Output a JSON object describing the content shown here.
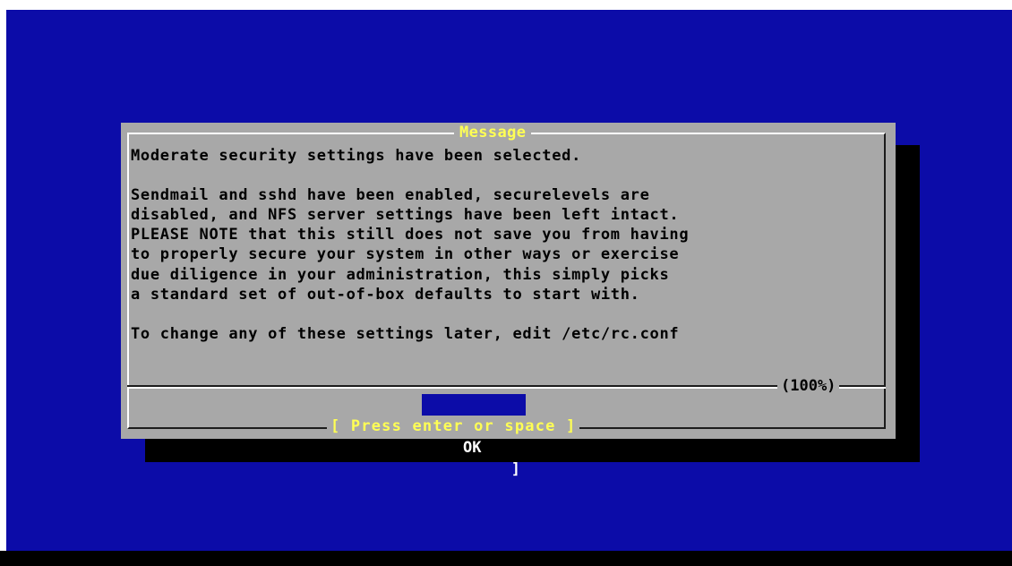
{
  "dialog": {
    "title": "Message",
    "lines": [
      "Moderate security settings have been selected.",
      "",
      "Sendmail and sshd have been enabled, securelevels are",
      "disabled, and NFS server settings have been left intact.",
      "PLEASE NOTE that this still does not save you from having",
      "to properly secure your system in other ways or exercise",
      "due diligence in your administration, this simply picks",
      "a standard set of out-of-box defaults to start with.",
      "",
      "To change any of these settings later, edit /etc/rc.conf"
    ],
    "scroll_percent": "(100%)",
    "ok_button": {
      "left_bracket": "[",
      "label": "OK",
      "right_bracket": "]"
    },
    "hint": "[ Press enter or space ]"
  },
  "colors": {
    "background": "#0c0ca8",
    "dialog": "#a8a8a8",
    "highlight": "#ffff54",
    "shadow": "#000000"
  }
}
